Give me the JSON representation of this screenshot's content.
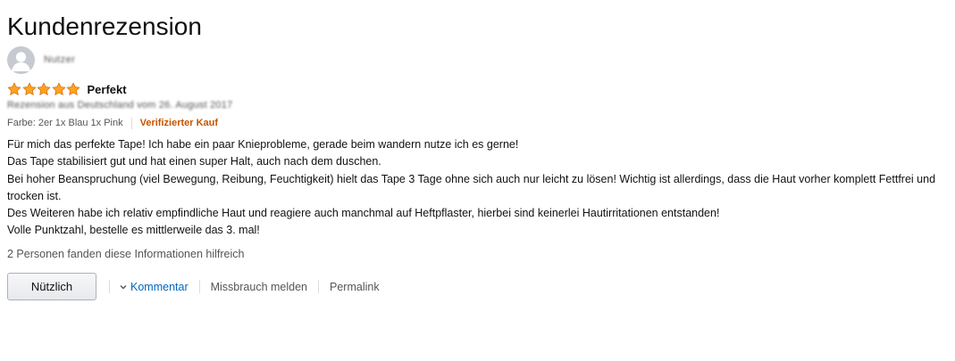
{
  "page": {
    "title": "Kundenrezension"
  },
  "profile": {
    "name": "Nutzer",
    "avatar_icon": "user-icon"
  },
  "review": {
    "rating": 5,
    "max_rating": 5,
    "title": "Perfekt",
    "date_line": "Rezension aus Deutschland vom 26. August 2017",
    "variant": "Farbe: 2er 1x Blau 1x Pink",
    "verified": "Verifizierter Kauf",
    "body": [
      "Für mich das perfekte Tape! Ich habe ein paar Knieprobleme, gerade beim wandern nutze ich es gerne!",
      "Das Tape stabilisiert gut und hat einen super Halt, auch nach dem duschen.",
      "Bei hoher Beanspruchung (viel Bewegung, Reibung, Feuchtigkeit) hielt das Tape 3 Tage ohne sich auch nur leicht zu lösen! Wichtig ist allerdings, dass die Haut vorher komplett Fettfrei und trocken ist.",
      "Des Weiteren habe ich relativ empfindliche Haut und reagiere auch manchmal auf Heftpflaster, hierbei sind keinerlei Hautirritationen entstanden!",
      "Volle Punktzahl, bestelle es mittlerweile das 3. mal!"
    ],
    "helpful_text": "2 Personen fanden diese Informationen hilfreich"
  },
  "actions": {
    "helpful_button": "Nützlich",
    "comment": "Kommentar",
    "report": "Missbrauch melden",
    "permalink": "Permalink"
  },
  "colors": {
    "star": "#ffa41c",
    "star_outline": "#de7921",
    "verified": "#c45500",
    "link": "#0066c0"
  }
}
